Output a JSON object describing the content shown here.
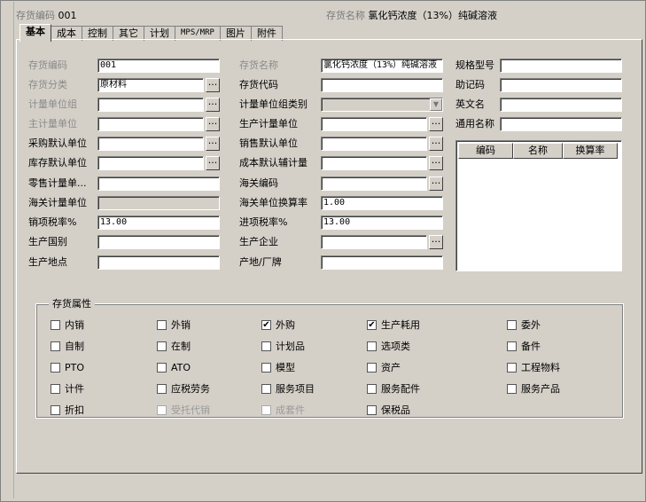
{
  "header": {
    "code_label": "存货编码",
    "code_value": "001",
    "name_label": "存货名称",
    "name_value": "氯化钙浓度（13%）纯碱溶液"
  },
  "tabs": [
    "基本",
    "成本",
    "控制",
    "其它",
    "计划",
    "MPS/MRP",
    "图片",
    "附件"
  ],
  "fields": {
    "inv_code": {
      "label": "存货编码",
      "value": "001"
    },
    "inv_class": {
      "label": "存货分类",
      "value": "原材料"
    },
    "unit_group": {
      "label": "计量单位组",
      "value": ""
    },
    "main_unit": {
      "label": "主计量单位",
      "value": ""
    },
    "purchase_unit": {
      "label": "采购默认单位",
      "value": ""
    },
    "stock_unit": {
      "label": "库存默认单位",
      "value": ""
    },
    "retail_unit": {
      "label": "零售计量单...",
      "value": ""
    },
    "customs_unit": {
      "label": "海关计量单位",
      "value": ""
    },
    "sales_tax": {
      "label": "销项税率%",
      "value": "13.00"
    },
    "country": {
      "label": "生产国别",
      "value": ""
    },
    "place": {
      "label": "生产地点",
      "value": ""
    },
    "inv_name": {
      "label": "存货名称",
      "value": "氯化钙浓度（13%）纯碱溶液"
    },
    "inv_alias_code": {
      "label": "存货代码",
      "value": ""
    },
    "unit_group_type": {
      "label": "计量单位组类别",
      "value": ""
    },
    "prod_unit": {
      "label": "生产计量单位",
      "value": ""
    },
    "sales_unit": {
      "label": "销售默认单位",
      "value": ""
    },
    "cost_unit": {
      "label": "成本默认辅计量",
      "value": ""
    },
    "customs_code": {
      "label": "海关编码",
      "value": ""
    },
    "customs_rate": {
      "label": "海关单位换算率",
      "value": "1.00"
    },
    "purchase_tax": {
      "label": "进项税率%",
      "value": "13.00"
    },
    "manufacturer": {
      "label": "生产企业",
      "value": ""
    },
    "origin_brand": {
      "label": "产地/厂牌",
      "value": ""
    },
    "spec": {
      "label": "规格型号",
      "value": ""
    },
    "mnemonic": {
      "label": "助记码",
      "value": ""
    },
    "english_name": {
      "label": "英文名",
      "value": ""
    },
    "common_name": {
      "label": "通用名称",
      "value": ""
    }
  },
  "unit_grid": {
    "columns": [
      "编码",
      "名称",
      "换算率"
    ]
  },
  "attributes": {
    "title": "存货属性",
    "items": [
      {
        "label": "内销",
        "checked": false,
        "disabled": false
      },
      {
        "label": "外销",
        "checked": false,
        "disabled": false
      },
      {
        "label": "外购",
        "checked": true,
        "disabled": false
      },
      {
        "label": "生产耗用",
        "checked": true,
        "disabled": false
      },
      {
        "label": "委外",
        "checked": false,
        "disabled": false
      },
      {
        "label": "自制",
        "checked": false,
        "disabled": false
      },
      {
        "label": "在制",
        "checked": false,
        "disabled": false
      },
      {
        "label": "计划品",
        "checked": false,
        "disabled": false
      },
      {
        "label": "选项类",
        "checked": false,
        "disabled": false
      },
      {
        "label": "备件",
        "checked": false,
        "disabled": false
      },
      {
        "label": "PTO",
        "checked": false,
        "disabled": false
      },
      {
        "label": "ATO",
        "checked": false,
        "disabled": false
      },
      {
        "label": "模型",
        "checked": false,
        "disabled": false
      },
      {
        "label": "资产",
        "checked": false,
        "disabled": false
      },
      {
        "label": "工程物料",
        "checked": false,
        "disabled": false
      },
      {
        "label": "计件",
        "checked": false,
        "disabled": false
      },
      {
        "label": "应税劳务",
        "checked": false,
        "disabled": false
      },
      {
        "label": "服务项目",
        "checked": false,
        "disabled": false
      },
      {
        "label": "服务配件",
        "checked": false,
        "disabled": false
      },
      {
        "label": "服务产品",
        "checked": false,
        "disabled": false
      },
      {
        "label": "折扣",
        "checked": false,
        "disabled": false
      },
      {
        "label": "受托代销",
        "checked": false,
        "disabled": true
      },
      {
        "label": "成套件",
        "checked": false,
        "disabled": true
      },
      {
        "label": "保税品",
        "checked": false,
        "disabled": false
      }
    ]
  },
  "ellipsis": "...",
  "dropdown_arrow": "▼",
  "checkmark": "✔"
}
